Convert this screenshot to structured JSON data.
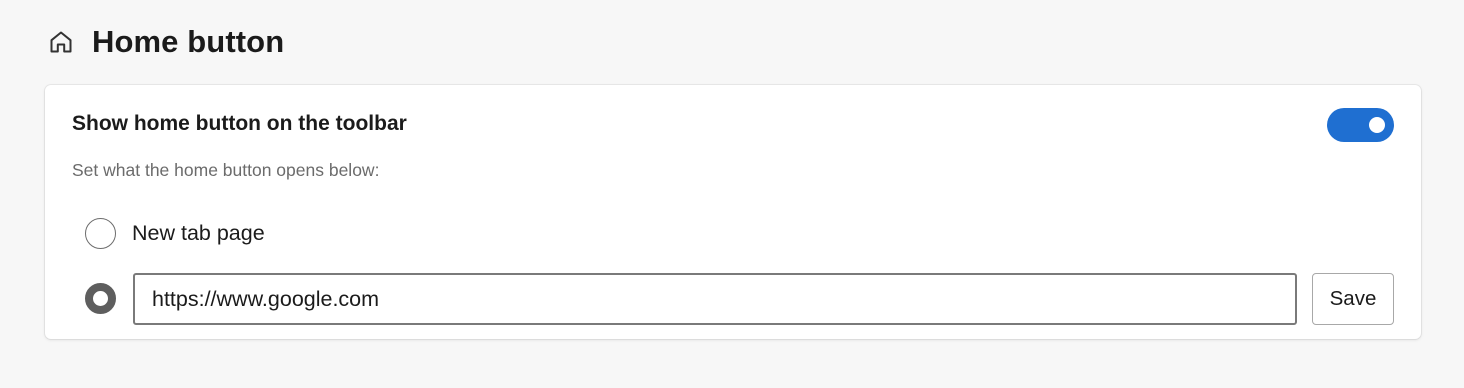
{
  "section": {
    "icon": "home-icon",
    "title": "Home button"
  },
  "card": {
    "toggle_label": "Show home button on the toolbar",
    "toggle_state": "on",
    "accent_color": "#1f6fd1",
    "helper_text": "Set what the home button opens below:",
    "options": [
      {
        "label": "New tab page",
        "checked": false
      },
      {
        "label": "",
        "checked": true
      }
    ],
    "url_input": {
      "value": "https://www.google.com",
      "placeholder": ""
    },
    "save_label": "Save"
  }
}
